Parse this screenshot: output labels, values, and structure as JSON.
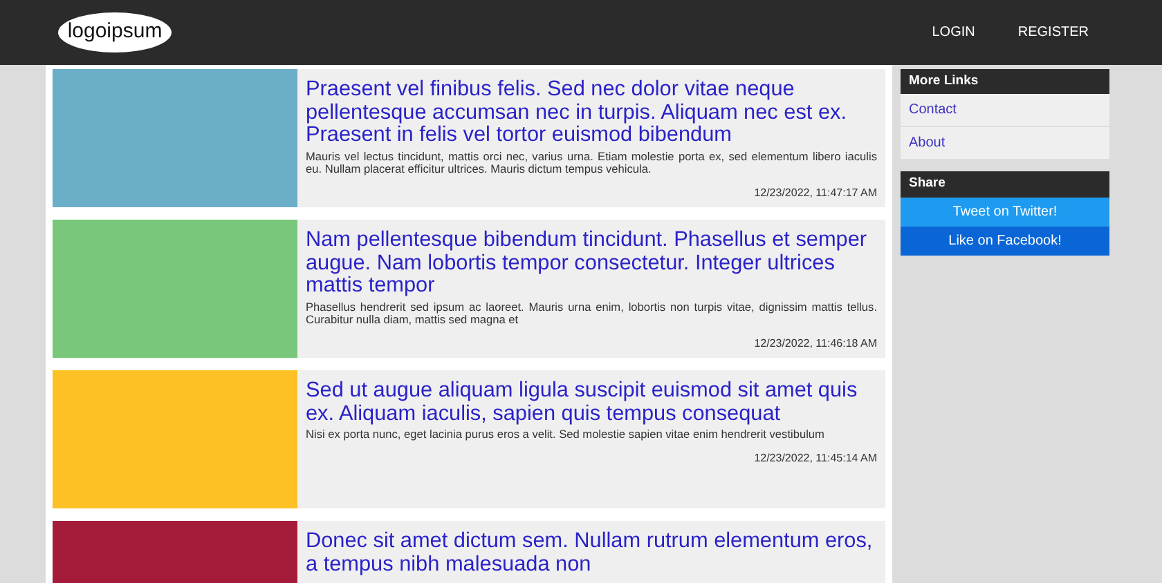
{
  "navbar": {
    "logo": "logoipsum",
    "links": [
      "LOGIN",
      "REGISTER"
    ]
  },
  "posts": [
    {
      "color": "#6aaec8",
      "title": "Praesent vel finibus felis. Sed nec dolor vitae neque pellentesque accumsan nec in turpis. Aliquam nec est ex. Praesent in felis vel tortor euismod bibendum",
      "body": "Mauris vel lectus tincidunt, mattis orci nec, varius urna. Etiam molestie porta ex, sed elementum libero iaculis eu. Nullam placerat efficitur ultrices. Mauris dictum tempus vehicula.",
      "date": "12/23/2022, 11:47:17 AM"
    },
    {
      "color": "#79c77a",
      "title": "Nam pellentesque bibendum tincidunt. Phasellus et semper augue. Nam lobortis tempor consectetur. Integer ultrices mattis tempor",
      "body": "Phasellus hendrerit sed ipsum ac laoreet. Mauris urna enim, lobortis non turpis vitae, dignissim mattis tellus. Curabitur nulla diam, mattis sed magna et",
      "date": "12/23/2022, 11:46:18 AM"
    },
    {
      "color": "#fdc125",
      "title": "Sed ut augue aliquam ligula suscipit euismod sit amet quis ex. Aliquam iaculis, sapien quis tempus consequat",
      "body": "Nisi ex porta nunc, eget lacinia purus eros a velit. Sed molestie sapien vitae enim hendrerit vestibulum",
      "date": "12/23/2022, 11:45:14 AM"
    },
    {
      "color": "#a51c3b",
      "title": "Donec sit amet dictum sem. Nullam rutrum elementum eros, a tempus nibh malesuada non"
    }
  ],
  "sidebar": {
    "more_links": {
      "title": "More Links",
      "links": [
        "Contact",
        "About"
      ]
    },
    "share": {
      "title": "Share",
      "buttons": [
        {
          "kind": "twitter",
          "label": "Tweet on Twitter!"
        },
        {
          "kind": "facebook",
          "label": "Like on Facebook!"
        }
      ]
    }
  }
}
